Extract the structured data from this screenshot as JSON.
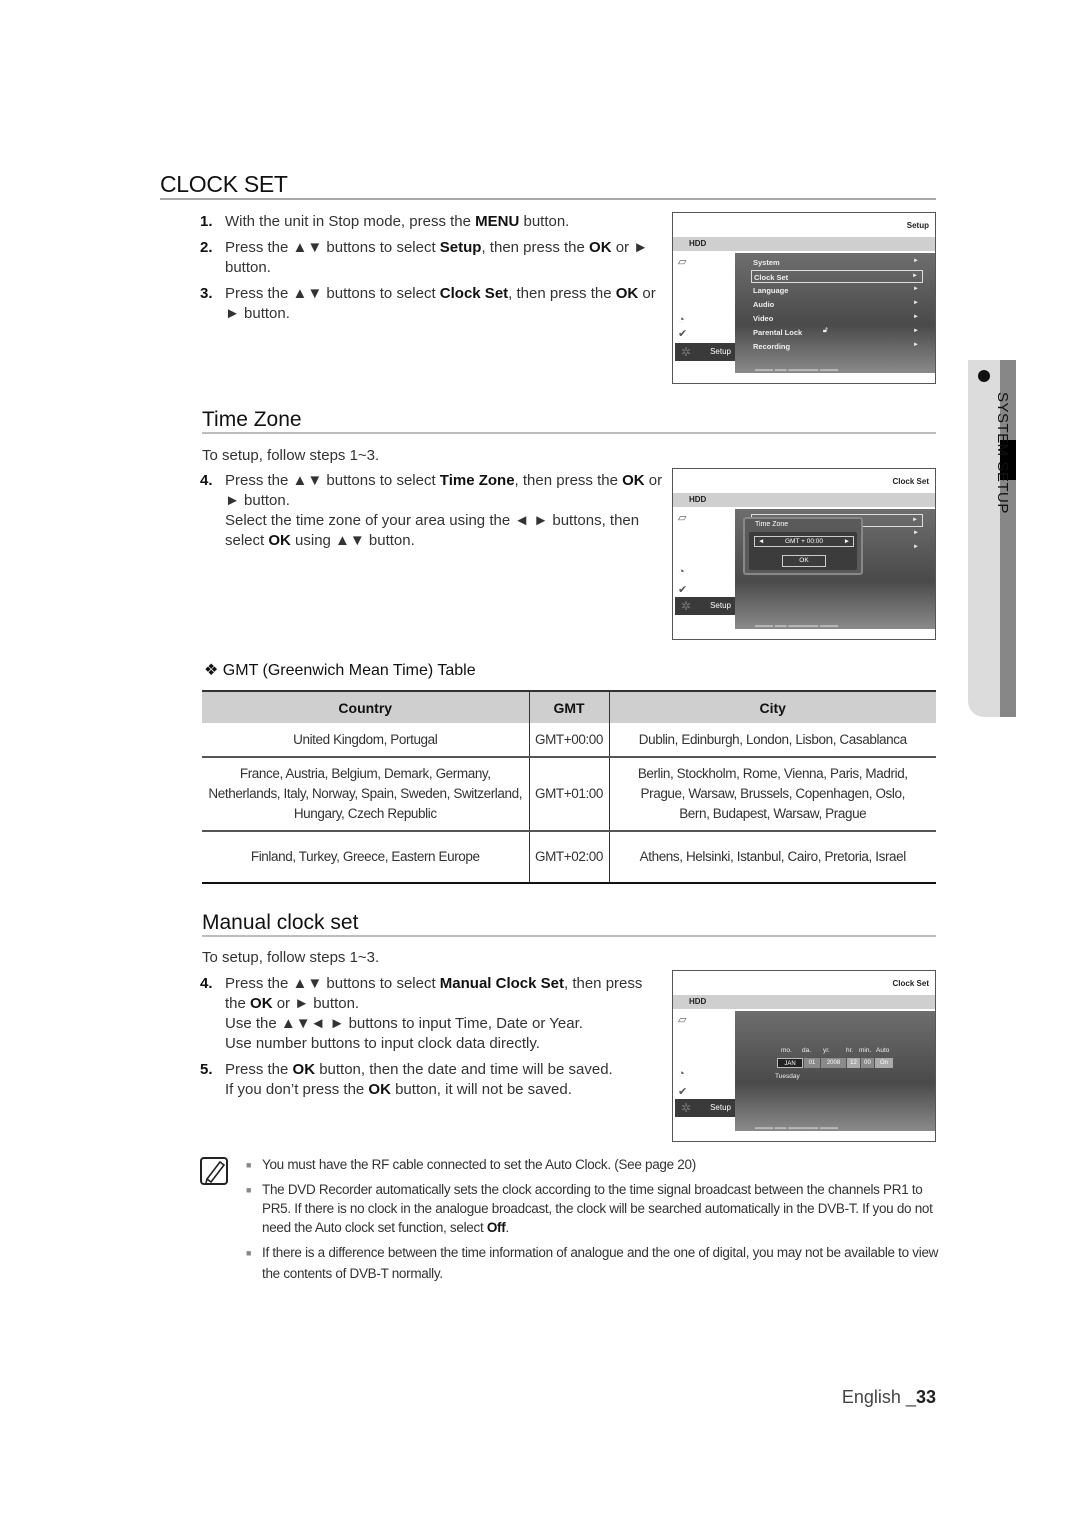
{
  "page_title": "CLOCK SET",
  "intro_steps": [
    {
      "num": "1.",
      "parts": [
        "With the unit in Stop mode, press the ",
        "MENU",
        " button."
      ]
    },
    {
      "num": "2.",
      "parts": [
        "Press the ▲▼ buttons to select ",
        "Setup",
        ", then press the ",
        "OK",
        " or ► button."
      ]
    },
    {
      "num": "3.",
      "parts": [
        "Press the ▲▼ buttons to select ",
        "Clock Set",
        ", then press the ",
        "OK",
        " or ► button."
      ]
    }
  ],
  "osd_setup": {
    "title": "Setup",
    "source": "HDD",
    "tab_label": "Setup",
    "menu": [
      {
        "label": "System",
        "selected": false
      },
      {
        "label": "Clock Set",
        "selected": true
      },
      {
        "label": "Language",
        "selected": false
      },
      {
        "label": "Audio",
        "selected": false
      },
      {
        "label": "Video",
        "selected": false
      },
      {
        "label": "Parental Lock",
        "selected": false,
        "icon": "unlock-icon"
      },
      {
        "label": "Recording",
        "selected": false
      }
    ],
    "arrow": "►"
  },
  "time_zone": {
    "heading": "Time Zone",
    "intro": "To setup, follow steps 1~3.",
    "step4": {
      "num": "4.",
      "parts": [
        "Press the ▲▼ buttons to select ",
        "Time Zone",
        ", then press the ",
        "OK",
        " or ► button."
      ]
    },
    "step4b": [
      "Select the time zone of your area using the ◄ ► buttons, then select ",
      "OK",
      " using ▲▼ button."
    ],
    "osd": {
      "title": "Clock Set",
      "source": "HDD",
      "tab_label": "Setup",
      "popup_title": "Time Zone",
      "value": "GMT + 00:00",
      "left_arrow": "◄",
      "right_arrow": "►",
      "ok_label": "OK",
      "arrow": "►"
    }
  },
  "gmt_table": {
    "heading": "❖ GMT (Greenwich Mean Time) Table",
    "columns": [
      "Country",
      "GMT",
      "City"
    ],
    "rows": [
      {
        "country": [
          "United Kingdom, Portugal"
        ],
        "gmt": "GMT+00:00",
        "city": [
          "Dublin, Edinburgh, London, Lisbon, Casablanca"
        ]
      },
      {
        "country": [
          "France, Austria, Belgium, Demark, Germany,",
          "Netherlands, Italy, Norway, Spain, Sweden, Switzerland,",
          "Hungary, Czech Republic"
        ],
        "gmt": "GMT+01:00",
        "city": [
          "Berlin, Stockholm, Rome, Vienna, Paris, Madrid,",
          "Prague, Warsaw, Brussels, Copenhagen, Oslo,",
          "Bern, Budapest, Warsaw, Prague"
        ]
      },
      {
        "country": [
          "Finland, Turkey, Greece, Eastern Europe"
        ],
        "gmt": "GMT+02:00",
        "city": [
          "Athens, Helsinki, Istanbul, Cairo, Pretoria, Israel"
        ]
      }
    ]
  },
  "manual_clock": {
    "heading": "Manual clock set",
    "intro": "To setup, follow steps 1~3.",
    "step4": {
      "num": "4.",
      "parts": [
        "Press the ▲▼ buttons to select ",
        "Manual Clock Set",
        ", then press the ",
        "OK",
        " or ► button."
      ]
    },
    "step4b": "Use the ▲▼◄ ► buttons to input Time, Date or Year.",
    "step4c": "Use number buttons to input clock data directly.",
    "step5": {
      "num": "5.",
      "parts": [
        "Press the ",
        "OK",
        " button, then the date and time will be saved."
      ]
    },
    "step5b": [
      "If you don’t press the ",
      "OK",
      " button, it will not be saved."
    ],
    "osd": {
      "title": "Clock Set",
      "source": "HDD",
      "tab_label": "Setup",
      "headers": [
        "mo.",
        "da.",
        "yr.",
        "hr.",
        "min.",
        "Auto"
      ],
      "values": [
        "JAN",
        "01",
        "2008",
        "12",
        "00",
        "On"
      ],
      "weekday": "Tuesday"
    }
  },
  "notes": [
    {
      "parts": [
        "You must have the RF cable connected to set the Auto Clock. (See page 20)"
      ]
    },
    {
      "parts": [
        "The DVD Recorder automatically sets the clock according to the time signal broadcast between the channels PR1 to PR5. If there is no clock in the analogue broadcast, the clock will be searched automatically in the DVB-T. If you do not need the Auto clock set function, select ",
        "Off",
        "."
      ]
    },
    {
      "parts": [
        "If there is a difference between the time information of analogue and the one of digital, you may not be available to view the contents of DVB-T normally."
      ]
    }
  ],
  "side_tab": "SYSTEM SETUP",
  "footer": {
    "language": "English _",
    "page": "33"
  }
}
